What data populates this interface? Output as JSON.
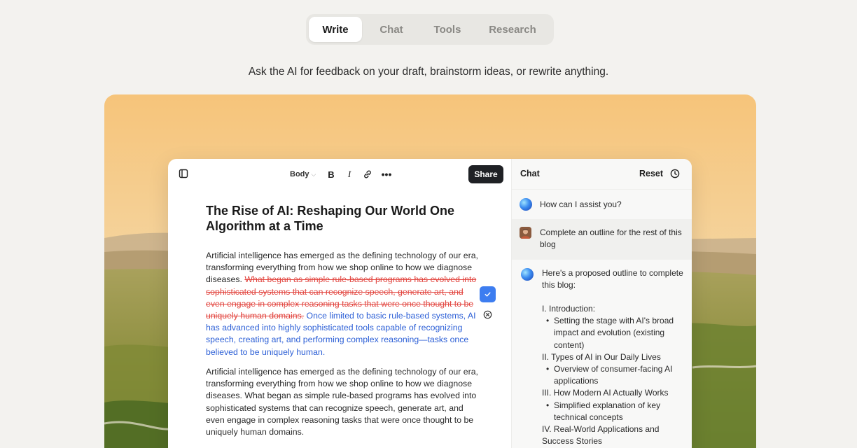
{
  "tabs": [
    {
      "label": "Write",
      "active": true
    },
    {
      "label": "Chat",
      "active": false
    },
    {
      "label": "Tools",
      "active": false
    },
    {
      "label": "Research",
      "active": false
    }
  ],
  "subtitle": "Ask the AI for feedback on your draft, brainstorm ideas, or rewrite anything.",
  "editor": {
    "toolbar": {
      "style_label": "Body",
      "bold_label": "B",
      "italic_label": "I",
      "more_label": "•••",
      "share_label": "Share"
    },
    "title": "The Rise of AI: Reshaping Our World One Algorithm at a Time",
    "para1": {
      "plain": "Artificial intelligence has emerged as the defining technology of our era, transforming everything from how we shop online to how we diagnose diseases. ",
      "deleted": "What began as simple rule-based programs has evolved into sophisticated systems that can recognize speech, generate art, and even engage in complex reasoning tasks that were once thought to be uniquely human domains.",
      "inserted": " Once limited to basic rule-based systems, AI has advanced into highly sophisticated tools capable of recognizing speech, creating art, and performing complex reasoning—tasks once believed to be uniquely human."
    },
    "para2": "Artificial intelligence has emerged as the defining technology of our era, transforming everything from how we shop online to how we diagnose diseases. What began as simple rule-based programs has evolved into sophisticated systems that can recognize speech, generate art, and even engage in complex reasoning tasks that were once thought to be uniquely human domains."
  },
  "chat": {
    "title": "Chat",
    "reset_label": "Reset",
    "messages": [
      {
        "role": "assistant",
        "text": "How can I assist you?"
      },
      {
        "role": "user",
        "text": "Complete an outline for the rest of this blog"
      },
      {
        "role": "assistant",
        "text": "Here's a proposed outline to complete this blog:"
      }
    ],
    "outline": [
      {
        "type": "section",
        "text": "I. Introduction:"
      },
      {
        "type": "bullet",
        "text": "Setting the stage with AI's broad impact and evolution (existing content)"
      },
      {
        "type": "section",
        "text": "II. Types of AI in Our Daily Lives"
      },
      {
        "type": "bullet",
        "text": "Overview of consumer-facing AI applications"
      },
      {
        "type": "section",
        "text": "III. How Modern AI Actually Works"
      },
      {
        "type": "bullet",
        "text": "Simplified explanation of key technical concepts"
      },
      {
        "type": "section",
        "text": "IV. Real-World Applications and Success Stories"
      }
    ]
  },
  "colors": {
    "accent": "#3d7df0",
    "deleted_text": "#e2453f",
    "inserted_text": "#2c5fd6",
    "share_button": "#1f2125"
  },
  "icons": {
    "sidebar": "sidebar-toggle-icon",
    "link": "link-icon",
    "history": "clock-icon",
    "accept": "check-icon",
    "reject": "close-circle-icon"
  }
}
